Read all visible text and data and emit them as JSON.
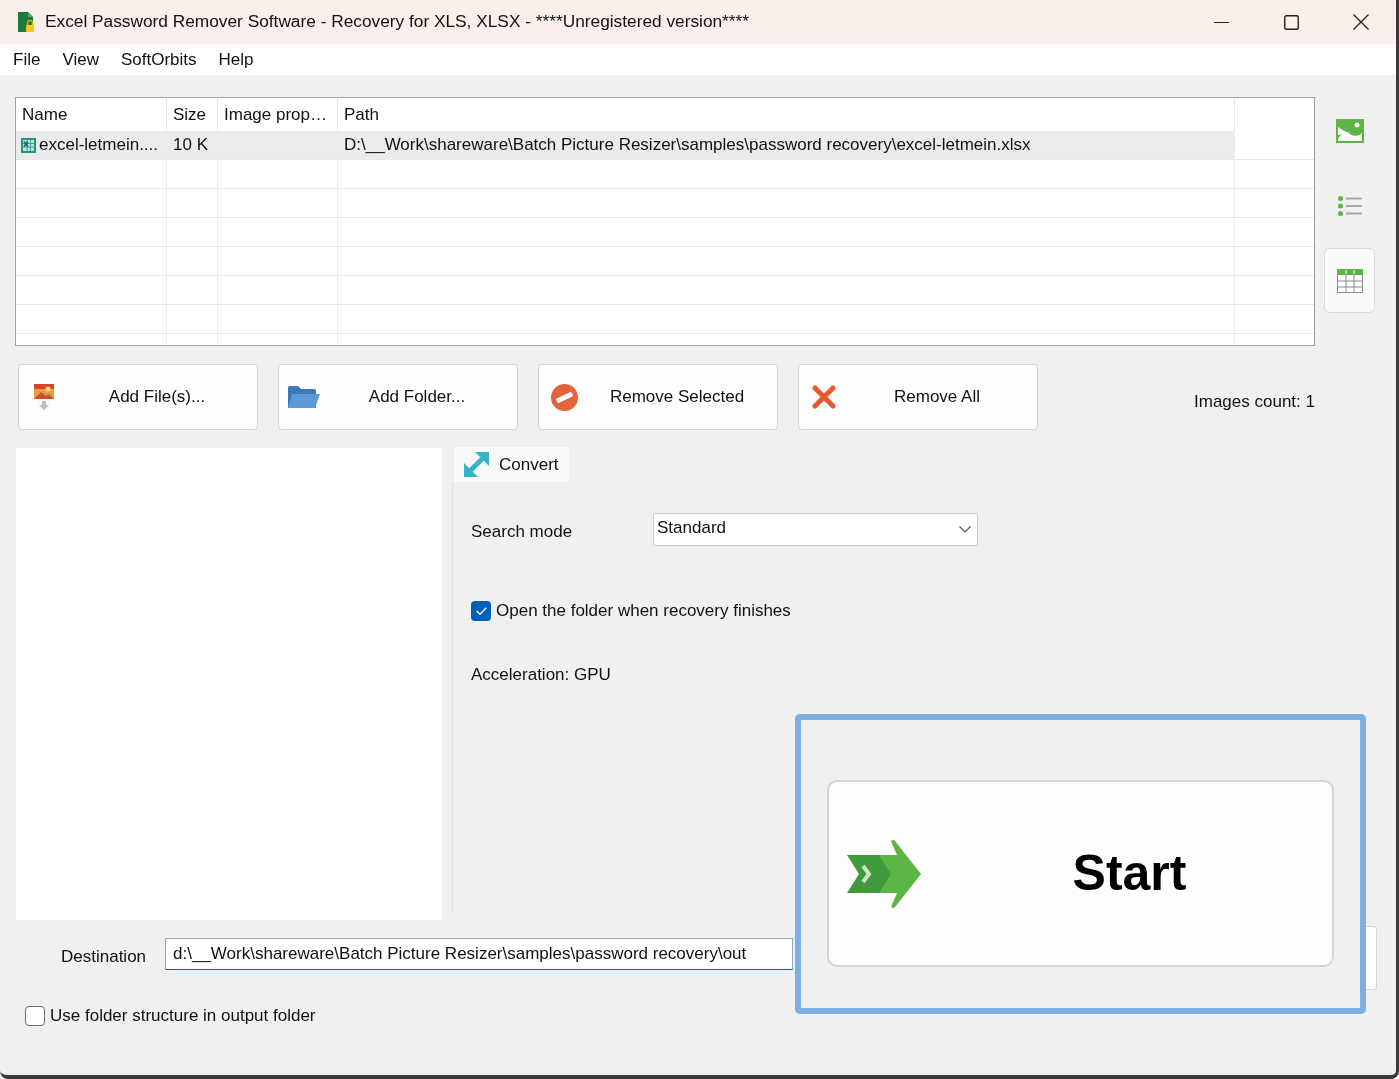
{
  "window": {
    "title": "Excel Password Remover Software - Recovery for XLS, XLSX - ****Unregistered version****"
  },
  "menu": [
    {
      "label": "File"
    },
    {
      "label": "View"
    },
    {
      "label": "SoftOrbits"
    },
    {
      "label": "Help"
    }
  ],
  "file_table": {
    "columns": [
      "Name",
      "Size",
      "Image prop…",
      "Path"
    ],
    "rows": [
      {
        "name": "excel-letmein....",
        "size": "10 K",
        "path": "D:\\__Work\\shareware\\Batch Picture Resizer\\samples\\password recovery\\excel-letmein.xlsx",
        "selected": true
      }
    ]
  },
  "view_buttons": [
    {
      "kind": "thumbnails",
      "selected": false
    },
    {
      "kind": "list",
      "selected": false
    },
    {
      "kind": "table",
      "selected": true
    }
  ],
  "actions": [
    {
      "kind": "add_files",
      "label": "Add File(s)..."
    },
    {
      "kind": "add_folder",
      "label": "Add Folder..."
    },
    {
      "kind": "remove_selected",
      "label": "Remove Selected"
    },
    {
      "kind": "remove_all",
      "label": "Remove All"
    }
  ],
  "images_count": "Images count: 1",
  "tabs": [
    {
      "label": "Convert",
      "selected": true
    }
  ],
  "search_mode": {
    "label": "Search mode",
    "value": "Standard"
  },
  "open_folder": {
    "label": "Open the folder when recovery finishes",
    "checked": true
  },
  "acceleration": "Acceleration: GPU",
  "start_button": {
    "label": "Start"
  },
  "destination": {
    "label": "Destination",
    "value": "d:\\__Work\\shareware\\Batch Picture Resizer\\samples\\password recovery\\out"
  },
  "folder_structure": {
    "label": "Use folder structure in output folder",
    "checked": false
  }
}
